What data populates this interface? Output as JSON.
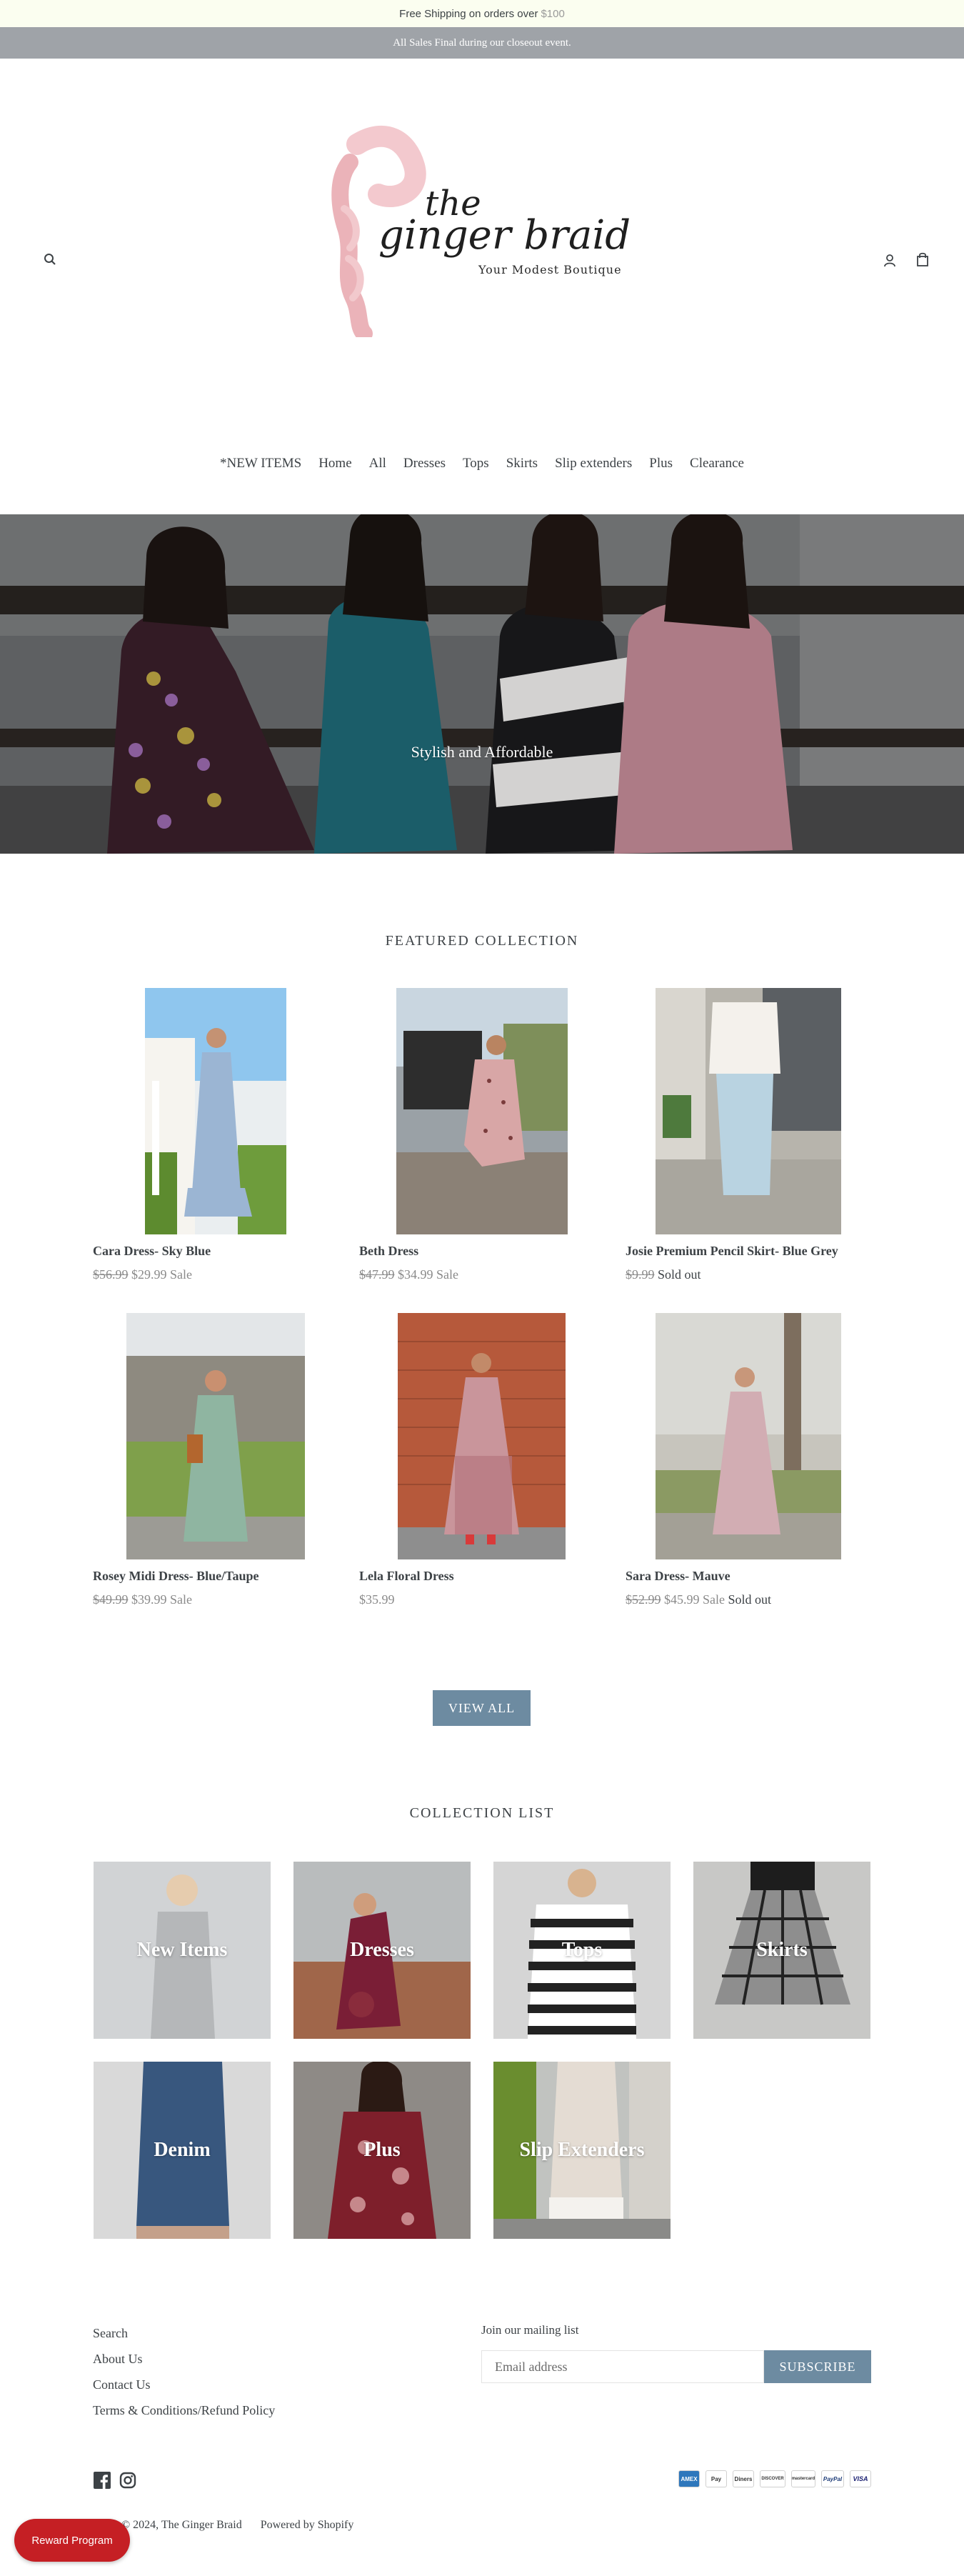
{
  "announcement": {
    "shipping_text": "Free Shipping on orders over",
    "shipping_amount": "$100",
    "sale_text": "All Sales Final during our closeout event."
  },
  "header": {
    "logo_title": "the ginger braid",
    "logo_tagline": "Your Modest Boutique",
    "search_icon": "search-icon",
    "account_icon": "person-icon",
    "cart_icon": "bag-icon"
  },
  "nav": [
    "*NEW ITEMS",
    "Home",
    "All",
    "Dresses",
    "Tops",
    "Skirts",
    "Slip extenders",
    "Plus",
    "Clearance"
  ],
  "hero": {
    "caption": "Stylish and Affordable"
  },
  "featured": {
    "title": "FEATURED COLLECTION",
    "products": [
      {
        "name": "Cara Dress- Sky Blue",
        "compare": "$56.99",
        "price": "$29.99",
        "sale": "Sale",
        "soldout": ""
      },
      {
        "name": "Beth Dress",
        "compare": "$47.99",
        "price": "$34.99",
        "sale": "Sale",
        "soldout": ""
      },
      {
        "name": "Josie Premium Pencil Skirt- Blue Grey",
        "compare": "$9.99",
        "price": "",
        "sale": "",
        "soldout": "Sold out"
      },
      {
        "name": "Rosey Midi Dress- Blue/Taupe",
        "compare": "$49.99",
        "price": "$39.99",
        "sale": "Sale",
        "soldout": ""
      },
      {
        "name": "Lela Floral Dress",
        "compare": "",
        "price": "$35.99",
        "sale": "",
        "soldout": ""
      },
      {
        "name": "Sara Dress- Mauve",
        "compare": "$52.99",
        "price": "$45.99",
        "sale": "Sale",
        "soldout": "Sold out"
      }
    ],
    "view_all": "VIEW ALL"
  },
  "collections": {
    "title": "COLLECTION LIST",
    "items": [
      "New Items",
      "Dresses",
      "Tops",
      "Skirts",
      "Denim",
      "Plus",
      "Slip Extenders"
    ]
  },
  "footer": {
    "links": [
      "Search",
      "About Us",
      "Contact Us",
      "Terms & Conditions/Refund Policy"
    ],
    "mailing_title": "Join our mailing list",
    "email_placeholder": "Email address",
    "subscribe": "SUBSCRIBE",
    "social": [
      "facebook-icon",
      "instagram-icon"
    ],
    "payments": [
      "AMEX",
      "Pay",
      "Diners",
      "DISCOVER",
      "mastercard",
      "PayPal",
      "VISA"
    ],
    "copyright": "© 2024, The Ginger Braid",
    "powered": "Powered by Shopify"
  },
  "reward": "Reward Program",
  "colors": {
    "accent": "#6d8ba1",
    "announcement_bg": "#fbfef0",
    "sale_bar_bg": "#9fa3a8",
    "reward_bg": "#c51f24",
    "logo_pink": "#e8a6ad"
  }
}
